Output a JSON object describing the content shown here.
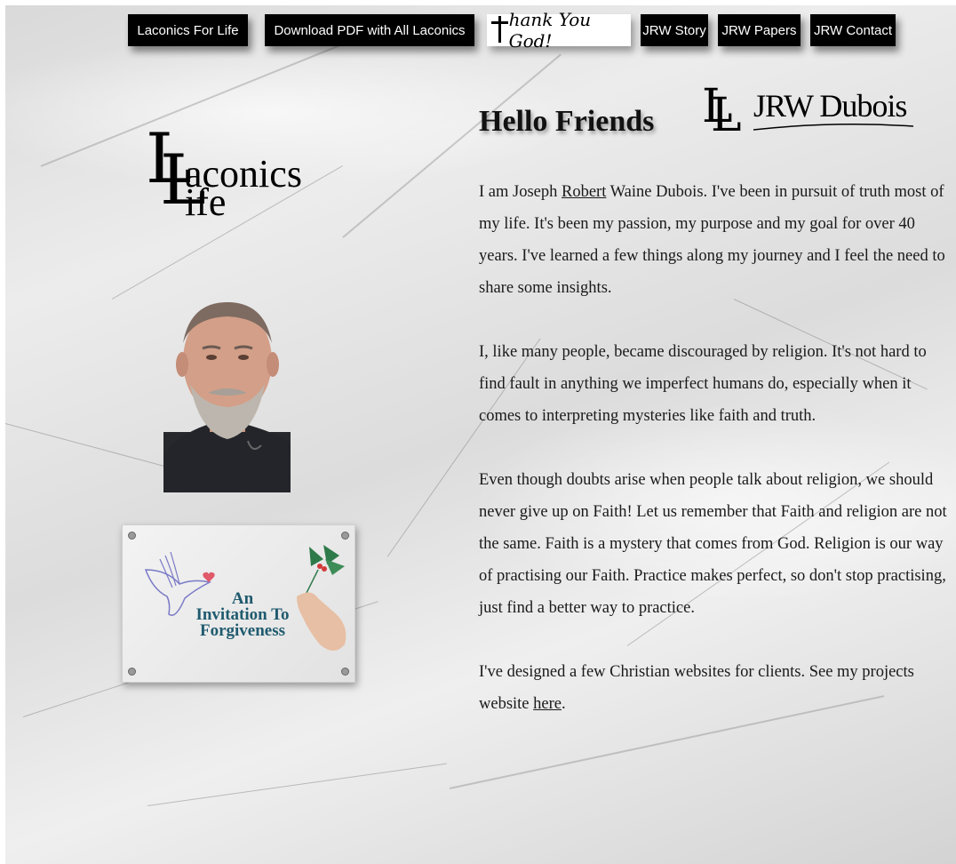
{
  "nav": {
    "items": [
      {
        "label": "Laconics For Life"
      },
      {
        "label": "Download PDF with All Laconics"
      },
      {
        "label": "hank You God!"
      },
      {
        "label": "JRW Story"
      },
      {
        "label": "JRW Papers"
      },
      {
        "label": "JRW Contact"
      }
    ]
  },
  "logos": {
    "laconics": {
      "initials": "L",
      "line1": "aconics",
      "line2": "ife"
    },
    "jrw": {
      "mark": "L",
      "name": "JRW Dubois"
    }
  },
  "card": {
    "title_line1": "An",
    "title_line2": "Invitation To",
    "title_line3": "Forgiveness"
  },
  "main": {
    "heading": "Hello Friends",
    "p1_before": "I am Joseph ",
    "p1_link": "Robert",
    "p1_after": " Waine Dubois. I've been in pursuit of truth most of my life. It's been my passion, my purpose and my goal for over 40 years. I've learned a few things along my journey and I feel the need to share some insights.",
    "p2": "I, like many people, became discouraged by religion. It's not hard to find fault in anything we imperfect humans do, especially when it comes to interpreting mysteries like faith and truth.",
    "p3": "Even though doubts arise when people talk about religion, we should never give up on Faith! Let us remember that Faith and religion are not the same. Faith is a mystery that comes from God. Religion is our way of practising our Faith. Practice makes perfect, so don't stop practising, just find a better way to practice.",
    "p4_before": "I've designed a few Christian websites for clients. See my projects website ",
    "p4_link": "here",
    "p4_after": "."
  },
  "colors": {
    "nav_bg": "#000000",
    "nav_text": "#ffffff",
    "card_title": "#1f5a6e",
    "heart": "#e05a6a",
    "holly": "#2f7a4a"
  }
}
